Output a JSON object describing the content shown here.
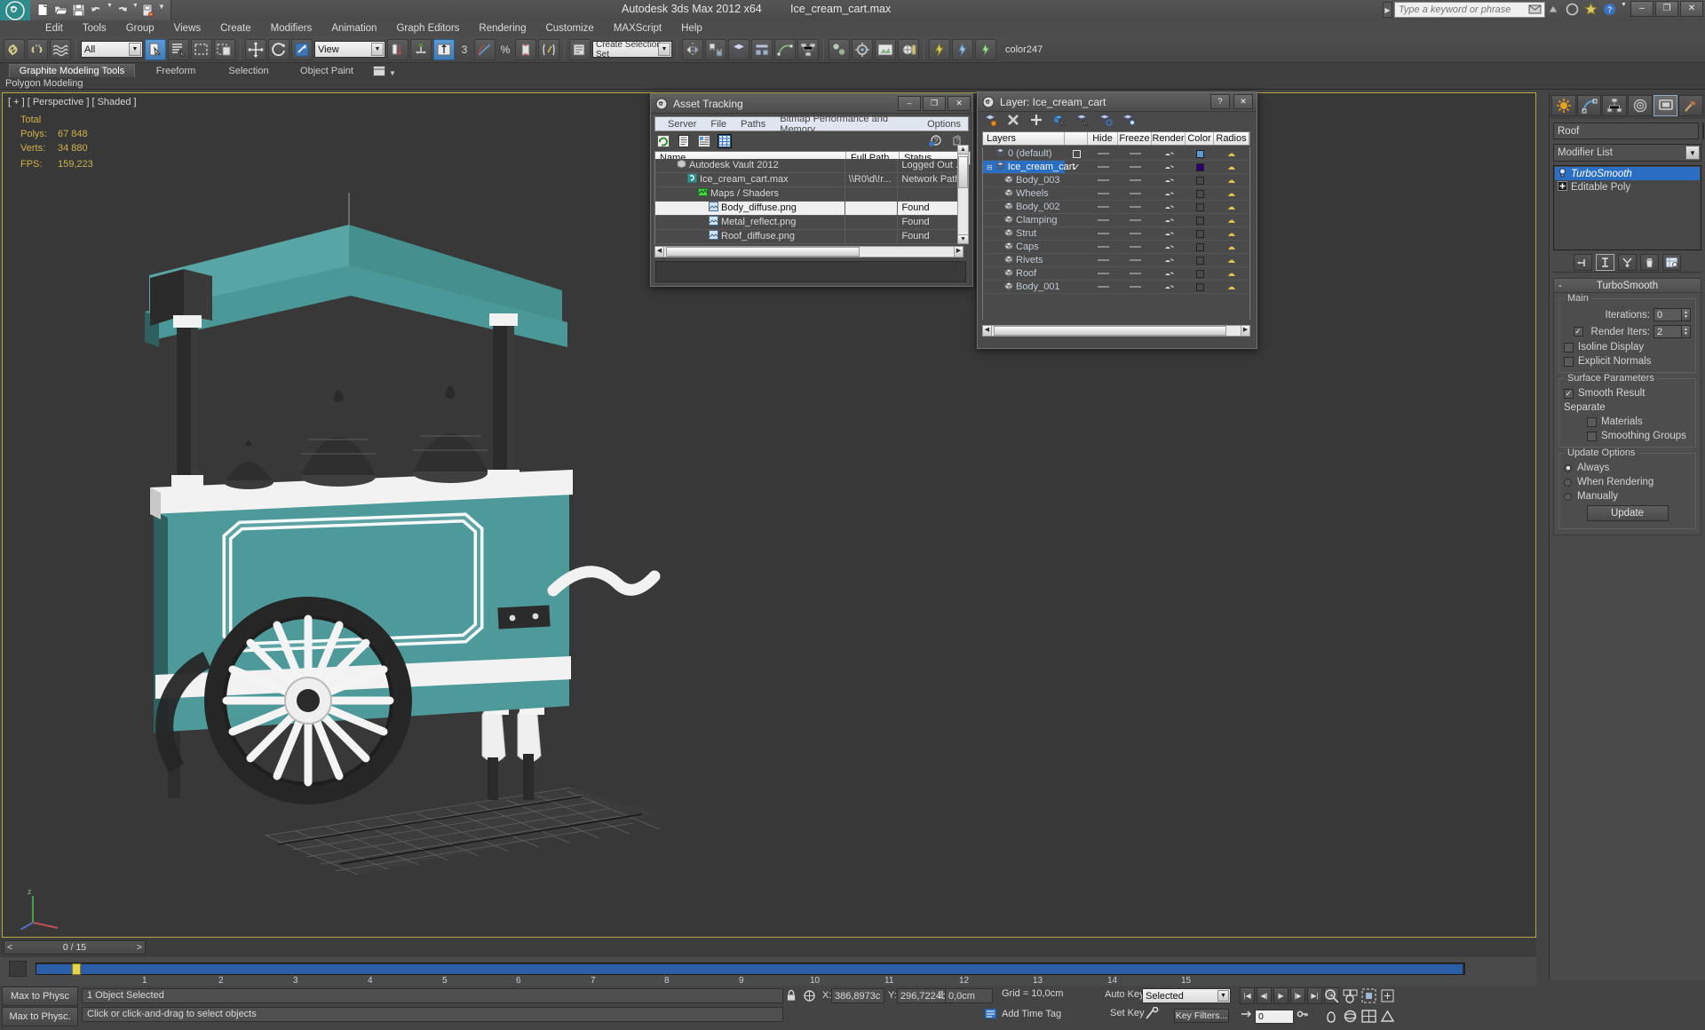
{
  "titlebar": {
    "app_title": "Autodesk 3ds Max  2012 x64",
    "file_name": "Ice_cream_cart.max",
    "search_placeholder": "Type a keyword or phrase",
    "quick_access": [
      "new-icon",
      "open-icon",
      "save-icon",
      "undo-icon",
      "redo-icon",
      "setproject-icon"
    ],
    "win_buttons": [
      "–",
      "❐",
      "✕"
    ]
  },
  "menu": [
    "Edit",
    "Tools",
    "Group",
    "Views",
    "Create",
    "Modifiers",
    "Animation",
    "Graph Editors",
    "Rendering",
    "Customize",
    "MAXScript",
    "Help"
  ],
  "toolbar": {
    "selection_filter": "All",
    "ref_coord_system": "View",
    "named_selection_placeholder": "Create Selection Set",
    "color_label": "color247",
    "angle_snap": "3"
  },
  "ribbon": {
    "tabs": [
      {
        "label": "Graphite Modeling Tools",
        "active": true
      },
      {
        "label": "Freeform",
        "active": false
      },
      {
        "label": "Selection",
        "active": false
      },
      {
        "label": "Object Paint",
        "active": false
      }
    ],
    "subtitle": "Polygon Modeling"
  },
  "viewport": {
    "label": "[ + ] [ Perspective ] [ Shaded ]",
    "stats": {
      "total_label": "Total",
      "polys_label": "Polys:",
      "polys_value": "67 848",
      "verts_label": "Verts:",
      "verts_value": "34 880",
      "fps_label": "FPS:",
      "fps_value": "159,223"
    }
  },
  "asset_tracking": {
    "title": "Asset Tracking",
    "menu": [
      "Server",
      "File",
      "Paths",
      "Bitmap Performance and Memory",
      "Options"
    ],
    "toolbar_icons": [
      "refresh-icon",
      "list-view-icon",
      "details-view-icon",
      "grid-view-icon"
    ],
    "help_icons": [
      "help-new-icon",
      "help-icon"
    ],
    "columns": [
      "Name",
      "Full Path",
      "Status"
    ],
    "rows": [
      {
        "icon": "vault-icon",
        "indent": 1,
        "name": "Autodesk Vault 2012",
        "path": "",
        "status": "Logged Out ...",
        "highlight": false
      },
      {
        "icon": "max-file-icon",
        "indent": 2,
        "name": "Ice_cream_cart.max",
        "path": "\\\\R0\\d\\!r...",
        "status": "Network Path",
        "highlight": false
      },
      {
        "icon": "maps-icon",
        "indent": 3,
        "name": "Maps / Shaders",
        "path": "",
        "status": "",
        "highlight": false
      },
      {
        "icon": "bitmap-icon",
        "indent": 4,
        "name": "Body_diffuse.png",
        "path": "",
        "status": "Found",
        "highlight": true
      },
      {
        "icon": "bitmap-icon",
        "indent": 4,
        "name": "Metal_reflect.png",
        "path": "",
        "status": "Found",
        "highlight": false
      },
      {
        "icon": "bitmap-icon",
        "indent": 4,
        "name": "Roof_diffuse.png",
        "path": "",
        "status": "Found",
        "highlight": false
      }
    ],
    "win_buttons": [
      "–",
      "❐",
      "✕"
    ]
  },
  "layer_dialog": {
    "title": "Layer: Ice_cream_cart",
    "toolbar_icons": [
      "new-layer-icon",
      "delete-layer-icon",
      "add-layer-icon",
      "select-objects-icon",
      "select-highlight-icon",
      "highlight-selected-icon",
      "layer-props-icon"
    ],
    "columns": [
      "Layers",
      "Hide",
      "Freeze",
      "Render",
      "Color",
      "Radios"
    ],
    "help_buttons": [
      "?",
      "✕"
    ],
    "rows": [
      {
        "name": "0 (default)",
        "indent": 1,
        "selected": false,
        "current": false,
        "color": "#5b9bd5",
        "icon": "layer-icon"
      },
      {
        "name": "Ice_cream_cart",
        "indent": 1,
        "selected": true,
        "current": true,
        "color": "#2b0070",
        "icon": "layer-icon"
      },
      {
        "name": "Body_003",
        "indent": 2,
        "selected": false,
        "current": false,
        "color": "",
        "icon": "object-icon"
      },
      {
        "name": "Wheels",
        "indent": 2,
        "selected": false,
        "current": false,
        "color": "",
        "icon": "object-icon"
      },
      {
        "name": "Body_002",
        "indent": 2,
        "selected": false,
        "current": false,
        "color": "",
        "icon": "object-icon"
      },
      {
        "name": "Clamping",
        "indent": 2,
        "selected": false,
        "current": false,
        "color": "",
        "icon": "object-icon"
      },
      {
        "name": "Strut",
        "indent": 2,
        "selected": false,
        "current": false,
        "color": "",
        "icon": "object-icon"
      },
      {
        "name": "Caps",
        "indent": 2,
        "selected": false,
        "current": false,
        "color": "",
        "icon": "object-icon"
      },
      {
        "name": "Rivets",
        "indent": 2,
        "selected": false,
        "current": false,
        "color": "",
        "icon": "object-icon"
      },
      {
        "name": "Roof",
        "indent": 2,
        "selected": false,
        "current": false,
        "color": "",
        "icon": "object-icon"
      },
      {
        "name": "Body_001",
        "indent": 2,
        "selected": false,
        "current": false,
        "color": "",
        "icon": "object-icon"
      }
    ]
  },
  "command_panel": {
    "tabs": [
      "create-tab",
      "modify-tab",
      "hierarchy-tab",
      "motion-tab",
      "display-tab",
      "utilities-tab"
    ],
    "active_tab_index": 4,
    "object_name": "Roof",
    "modifier_list_label": "Modifier List",
    "stack": [
      {
        "label": "TurboSmooth",
        "active": true,
        "icon": "lightbulb-icon"
      },
      {
        "label": "Editable Poly",
        "active": false,
        "icon": "plus-box-icon"
      }
    ],
    "stack_buttons": [
      "pin-stack-icon",
      "show-end-result-icon",
      "make-unique-icon",
      "remove-modifier-icon",
      "configure-sets-icon"
    ],
    "rollout": {
      "title": "TurboSmooth",
      "collapse_glyph": "-",
      "groups": [
        {
          "label": "Main",
          "fields": [
            {
              "type": "spinner",
              "label": "Iterations:",
              "value": "0"
            },
            {
              "type": "check-spinner",
              "label": "Render Iters:",
              "value": "2",
              "checked": true
            },
            {
              "type": "checkbox",
              "label": "Isoline Display",
              "checked": false
            },
            {
              "type": "checkbox",
              "label": "Explicit Normals",
              "checked": false
            }
          ]
        },
        {
          "label": "Surface Parameters",
          "fields": [
            {
              "type": "checkbox",
              "label": "Smooth Result",
              "checked": true
            },
            {
              "type": "text",
              "label": "Separate"
            },
            {
              "type": "checkbox",
              "label": "Materials",
              "checked": false,
              "indent": true
            },
            {
              "type": "checkbox",
              "label": "Smoothing Groups",
              "checked": false,
              "indent": true
            }
          ]
        },
        {
          "label": "Update Options",
          "fields": [
            {
              "type": "radio",
              "label": "Always",
              "checked": true
            },
            {
              "type": "radio",
              "label": "When Rendering",
              "checked": false
            },
            {
              "type": "radio",
              "label": "Manually",
              "checked": false
            },
            {
              "type": "button",
              "label": "Update"
            }
          ]
        }
      ]
    }
  },
  "timeline": {
    "current_frame_label": "0 / 15",
    "prev_glyph": "<",
    "next_glyph": ">",
    "ticks": [
      "1",
      "2",
      "3",
      "4",
      "5",
      "6",
      "7",
      "8",
      "9",
      "10",
      "11",
      "12",
      "13",
      "14",
      "15"
    ],
    "marker_frame": 0,
    "range_end": 15
  },
  "statusbar": {
    "max_to_physx_line1": "Max to Physc",
    "max_to_physx_line2": "Max to Physc.",
    "selection_info": "1 Object Selected",
    "prompt": "Click or click-and-drag to select objects",
    "coords": [
      {
        "axis": "X:",
        "value": "386,8973c"
      },
      {
        "axis": "Y:",
        "value": "296,7224c"
      },
      {
        "axis": "Z:",
        "value": "0,0cm"
      }
    ],
    "grid_info": "Grid = 10,0cm",
    "add_time_tag": "Add Time Tag",
    "auto_key": "Auto Key",
    "set_key": "Set Key",
    "key_filters": "Key Filters...",
    "selection_set": "Selected",
    "frame_value": "0",
    "lock_icon": "lock-icon",
    "snap_icon": "snap-icon"
  },
  "colors": {
    "accent_blue": "#2a6fc4",
    "viewport_border": "#b5a642",
    "model_teal": "#4e9a9a",
    "stat_yellow": "#d0b24a"
  }
}
